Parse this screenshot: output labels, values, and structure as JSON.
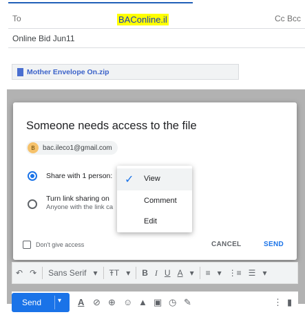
{
  "compose": {
    "to_label": "To",
    "recipient": "BACоnline.il",
    "cc_bcc": "Cc Bcc",
    "subject": "Online Bid Jun11",
    "attachment": "Mother Envelope On.zip"
  },
  "dialog": {
    "title": "Someone needs access to the file",
    "chip_initial": "B",
    "chip_email": "bac.ileco1@gmail.com",
    "option_share": "Share with 1 person:",
    "option_link": "Turn link sharing on",
    "option_link_sub": "Anyone with the link ca",
    "dont_give": "Don't give access",
    "cancel": "CANCEL",
    "send": "SEND"
  },
  "permission_menu": {
    "items": [
      {
        "label": "View",
        "selected": true
      },
      {
        "label": "Comment",
        "selected": false
      },
      {
        "label": "Edit",
        "selected": false
      }
    ]
  },
  "format_bar": {
    "undo": "↶",
    "redo": "↷",
    "font": "Sans Serif",
    "font_arrow": "▾",
    "size_icon": "ŦT",
    "bold": "B",
    "italic": "I",
    "underline": "U",
    "text_color": "A",
    "align": "≡",
    "numbered": "⋮≡",
    "bulleted": "☰"
  },
  "send_bar": {
    "send": "Send",
    "arrow": "▾"
  },
  "colors": {
    "accent": "#1a73e8",
    "highlight": "#ffff00",
    "recipient_text": "#1a3bb8"
  }
}
